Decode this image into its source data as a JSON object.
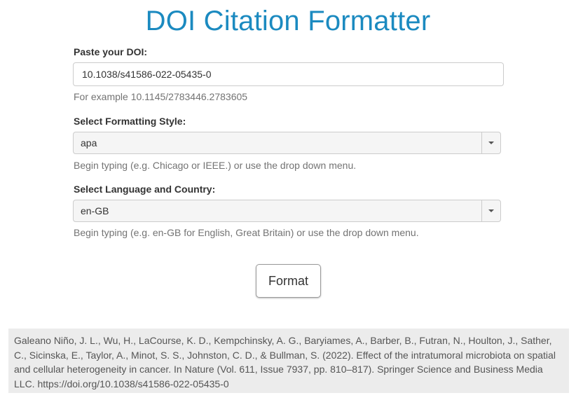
{
  "page": {
    "title": "DOI Citation Formatter"
  },
  "doi": {
    "label": "Paste your DOI:",
    "value": "10.1038/s41586-022-05435-0",
    "help": "For example 10.1145/2783446.2783605"
  },
  "style": {
    "label": "Select Formatting Style:",
    "selected": "apa",
    "help": "Begin typing (e.g. Chicago or IEEE.) or use the drop down menu."
  },
  "locale": {
    "label": "Select Language and Country:",
    "selected": "en-GB",
    "help": "Begin typing (e.g. en-GB for English, Great Britain) or use the drop down menu."
  },
  "actions": {
    "format_label": "Format"
  },
  "result": {
    "citation": "Galeano Niño, J. L., Wu, H., LaCourse, K. D., Kempchinsky, A. G., Baryiames, A., Barber, B., Futran, N., Houlton, J., Sather, C., Sicinska, E., Taylor, A., Minot, S. S., Johnston, C. D., & Bullman, S. (2022). Effect of the intratumoral microbiota on spatial and cellular heterogeneity in cancer. In Nature (Vol. 611, Issue 7937, pp. 810–817). Springer Science and Business Media LLC. https://doi.org/10.1038/s41586-022-05435-0"
  },
  "colors": {
    "title": "#1b8ac0",
    "result_background": "#ececec",
    "select_background": "#f5f5f5"
  },
  "icons": {
    "select_arrow": "caret-down-icon"
  }
}
